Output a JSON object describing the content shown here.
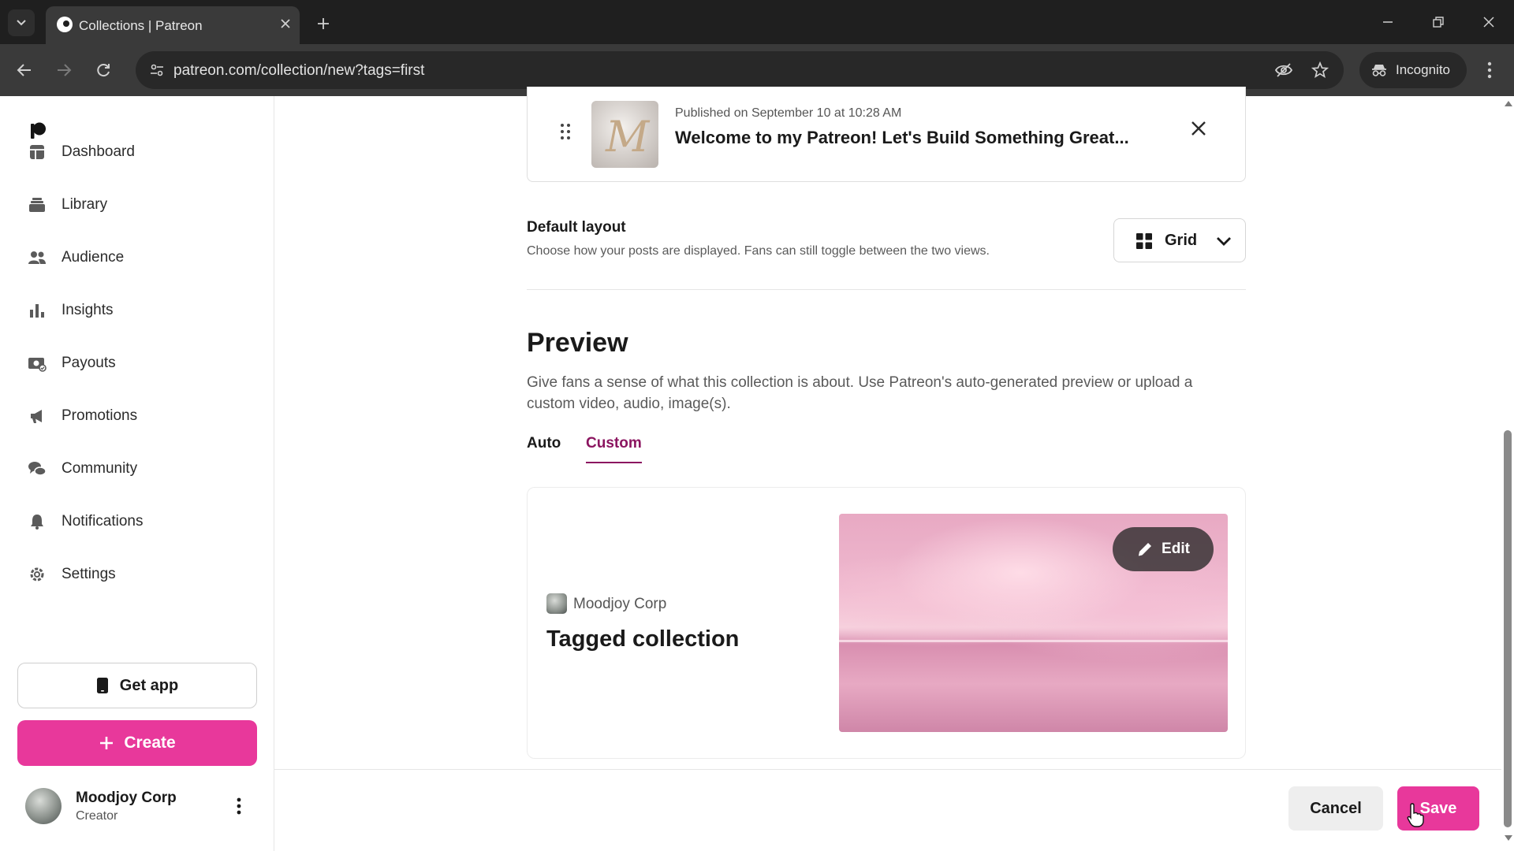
{
  "browser": {
    "tab_title": "Collections | Patreon",
    "url": "patreon.com/collection/new?tags=first",
    "incognito_label": "Incognito"
  },
  "sidebar": {
    "items": [
      {
        "label": "Dashboard",
        "icon": "dashboard-icon"
      },
      {
        "label": "Library",
        "icon": "library-icon"
      },
      {
        "label": "Audience",
        "icon": "audience-icon"
      },
      {
        "label": "Insights",
        "icon": "insights-icon"
      },
      {
        "label": "Payouts",
        "icon": "payouts-icon"
      },
      {
        "label": "Promotions",
        "icon": "promotions-icon"
      },
      {
        "label": "Community",
        "icon": "community-icon"
      },
      {
        "label": "Notifications",
        "icon": "notifications-icon"
      },
      {
        "label": "Settings",
        "icon": "settings-icon"
      }
    ],
    "get_app_label": "Get app",
    "create_label": "Create",
    "profile": {
      "name": "Moodjoy Corp",
      "role": "Creator"
    }
  },
  "post": {
    "meta": "Published on September 10 at 10:28 AM",
    "title": "Welcome to my Patreon! Let's Build Something Great..."
  },
  "layout": {
    "title": "Default layout",
    "description": "Choose how your posts are displayed. Fans can still toggle between the two views.",
    "selected": "Grid"
  },
  "preview": {
    "title": "Preview",
    "description": "Give fans a sense of what this collection is about. Use Patreon's auto-generated preview or upload a custom video, audio, image(s).",
    "tabs": [
      {
        "label": "Auto",
        "active": false
      },
      {
        "label": "Custom",
        "active": true
      }
    ],
    "card": {
      "creator_name": "Moodjoy Corp",
      "collection_title": "Tagged collection",
      "edit_label": "Edit"
    }
  },
  "footer": {
    "cancel_label": "Cancel",
    "save_label": "Save"
  },
  "colors": {
    "brand_pink": "#e8389b",
    "active_tab": "#8b1560"
  }
}
